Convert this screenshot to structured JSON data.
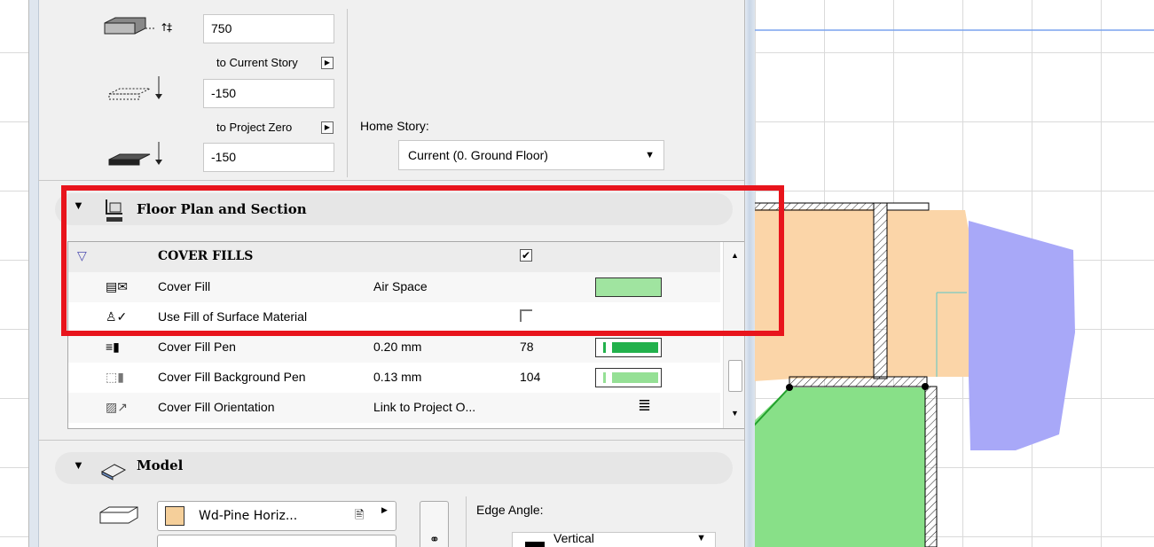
{
  "elevation": {
    "top_value": "750",
    "to_current_story": "to Current Story",
    "offset_value": "-150",
    "to_project_zero": "to Project Zero",
    "bottom_value": "-150"
  },
  "home_story": {
    "label": "Home Story:",
    "value": "Current (0. Ground Floor)"
  },
  "section_floor_plan": {
    "title": "Floor Plan and Section"
  },
  "cover_fills": {
    "group_title": "COVER FILLS",
    "group_checked": true,
    "rows": [
      {
        "name": "Cover Fill",
        "value": "Air Space",
        "num": "",
        "swatch": "#a0e4a0"
      },
      {
        "name": "Use Fill of Surface Material",
        "value": "",
        "num": "",
        "checked": false
      },
      {
        "name": "Cover Fill Pen",
        "value": "0.20 mm",
        "num": "78",
        "swatch": "#22b14c"
      },
      {
        "name": "Cover Fill Background Pen",
        "value": "0.13 mm",
        "num": "104",
        "swatch": "#95e095"
      },
      {
        "name": "Cover Fill Orientation",
        "value": "Link to Project O...",
        "num": ""
      }
    ]
  },
  "section_model": {
    "title": "Model",
    "material": "Wd-Pine Horiz...",
    "material_color": "#f5cf9a",
    "edge_angle_label": "Edge Angle:",
    "edge_angle_value": "Vertical"
  },
  "colors": {
    "highlight": "#e8141c",
    "fill_orange": "#fbd5a8",
    "fill_green": "#88e088",
    "fill_blue": "#a8a8f8"
  }
}
